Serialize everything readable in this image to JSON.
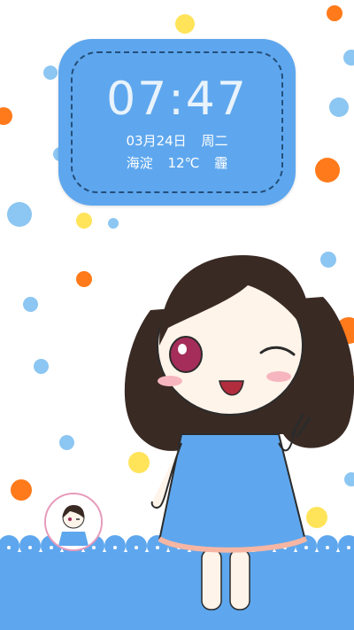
{
  "clock_widget": {
    "time": "07:47",
    "date": "03月24日",
    "weekday": "周二",
    "location": "海淀",
    "temperature": "12℃",
    "weather_icon_text": "霾"
  },
  "avatar": {
    "icon": "user-avatar-icon"
  },
  "colors": {
    "widget_blue": "#5ea7ee",
    "dot_blue": "#8cc6f2",
    "dot_orange": "#ff7a1a",
    "dot_yellow": "#ffe45a"
  }
}
